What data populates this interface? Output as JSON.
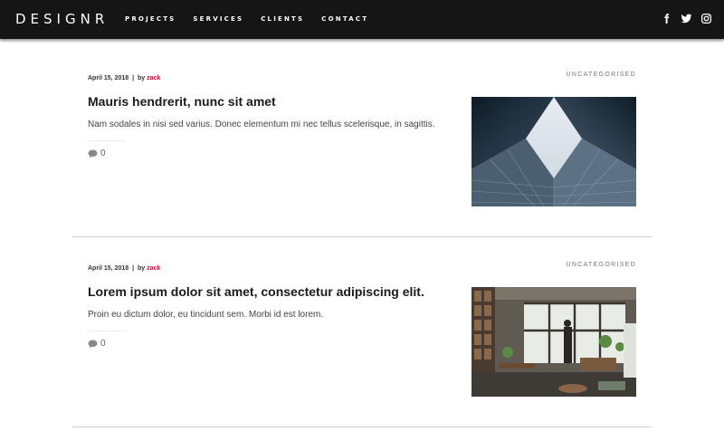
{
  "site": {
    "logo": "DESIGNR"
  },
  "nav": {
    "items": [
      {
        "label": "PROJECTS"
      },
      {
        "label": "SERVICES"
      },
      {
        "label": "CLIENTS"
      },
      {
        "label": "CONTACT"
      }
    ]
  },
  "social": {
    "icons": [
      "facebook-icon",
      "twitter-icon",
      "instagram-icon"
    ]
  },
  "colors": {
    "header_bg": "#151515",
    "author_accent": "#d0103a"
  },
  "posts": [
    {
      "date": "April 15, 2018",
      "separator": "|",
      "by": "by",
      "author": "zack",
      "category": "UNCATEGORISED",
      "title": "Mauris hendrerit, nunc sit amet",
      "excerpt": "Nam sodales in nisi sed varius. Donec elementum mi nec tellus scelerisque, in sagittis.",
      "comment_count": "0",
      "image": "skyscraper-photo"
    },
    {
      "date": "April 15, 2018",
      "separator": "|",
      "by": "by",
      "author": "zack",
      "category": "UNCATEGORISED",
      "title": "Lorem ipsum dolor sit amet, consectetur adipiscing elit.",
      "excerpt": "Proin eu dictum dolor, eu tincidunt sem. Morbi id est lorem.",
      "comment_count": "0",
      "image": "interior-photo"
    }
  ]
}
